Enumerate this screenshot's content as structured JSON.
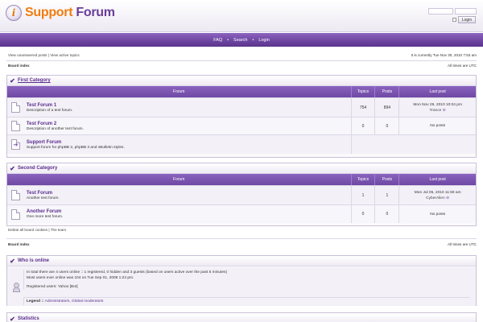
{
  "header": {
    "logo_support": "Support",
    "logo_forum": "Forum",
    "login_label": "Login"
  },
  "nav": {
    "faq": "FAQ",
    "sep1": "•",
    "search": "Search",
    "sep2": "•",
    "login": "Login"
  },
  "toplinks": {
    "unanswered": "View unanswered posts",
    "sep": "|",
    "active": "View active topics"
  },
  "current_time": "It is currently Tue Nov 30, 2010 7:53 am",
  "breadcrumb": "Board index",
  "timezone": "All times are UTC",
  "categories": [
    {
      "title": "First Category",
      "headers": {
        "forum": "Forum",
        "topics": "Topics",
        "posts": "Posts",
        "last_post": "Last post"
      },
      "forums": [
        {
          "name": "Test Forum 1",
          "desc": "Description of a test forum.",
          "topics": "754",
          "posts": "894",
          "last_date": "Mon Nov 29, 2010 10:04 pm",
          "last_user": "Trance"
        },
        {
          "name": "Test Forum 2",
          "desc": "Description of another test forum.",
          "topics": "0",
          "posts": "0",
          "last_date": "No posts",
          "last_user": ""
        },
        {
          "name": "Support Forum",
          "desc": "Support forum for phpBB 2, phpBB 3 and vBulletin styles.",
          "topics": "",
          "posts": "",
          "last_date": "",
          "last_user": ""
        }
      ]
    },
    {
      "title": "Second Category",
      "headers": {
        "forum": "Forum",
        "topics": "Topics",
        "posts": "Posts",
        "last_post": "Last post"
      },
      "forums": [
        {
          "name": "Test Forum",
          "desc": "Another test forum.",
          "topics": "1",
          "posts": "1",
          "last_date": "Mon Jul 05, 2010 11:59 am",
          "last_user": "CyberAlien"
        },
        {
          "name": "Another Forum",
          "desc": "One more test forum.",
          "topics": "0",
          "posts": "0",
          "last_date": "No posts",
          "last_user": ""
        }
      ]
    }
  ],
  "bottom_links": {
    "delete_cookies": "Delete all board cookies",
    "sep": "|",
    "team": "The team"
  },
  "who_online": {
    "title": "Who is online",
    "line1": "In total there are 4 users online :: 1 registered, 0 hidden and 3 guests (based on users active over the past 5 minutes)",
    "line2": "Most users ever online was 104 on Tue Sep 01, 2009 1:24 pm.",
    "line3": "Registered users: Yahoo [Bot]",
    "legend_label": "Legend ::",
    "legend_groups": "Administrators, Global moderators"
  },
  "statistics_title": "Statistics",
  "icons": {
    "checkmark": "✔",
    "arrow": "➔",
    "view_latest": "⊕"
  }
}
